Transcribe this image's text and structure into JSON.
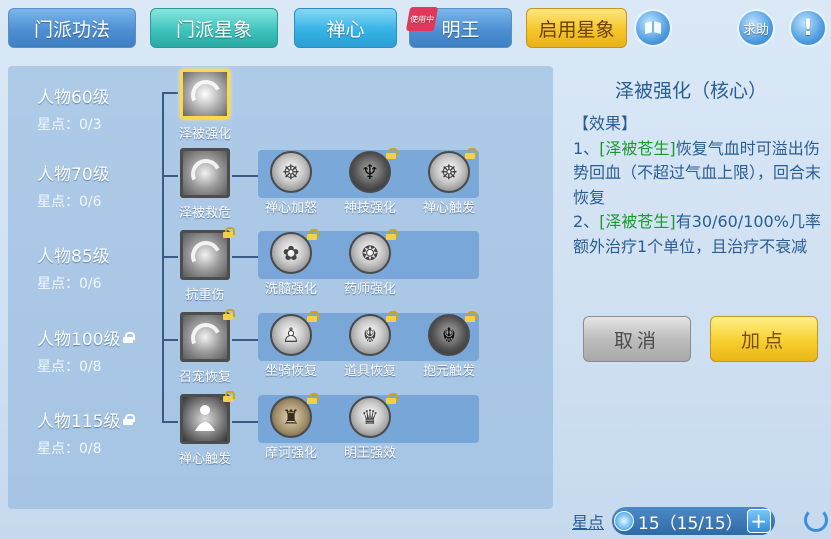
{
  "tabs": [
    {
      "label": "门派功法"
    },
    {
      "label": "门派星象"
    },
    {
      "label": "禅心"
    },
    {
      "label": "明王",
      "badge": "使用中"
    },
    {
      "label": "启用星象"
    }
  ],
  "help_label": "求助",
  "alert_label": "!",
  "levels": [
    {
      "label": "人物60级",
      "points": "星点：0/3",
      "locked": false
    },
    {
      "label": "人物70级",
      "points": "星点：0/6",
      "locked": false
    },
    {
      "label": "人物85级",
      "points": "星点：0/6",
      "locked": false
    },
    {
      "label": "人物100级",
      "points": "星点：0/8",
      "locked": true
    },
    {
      "label": "人物115级",
      "points": "星点：0/8",
      "locked": true
    }
  ],
  "core_skills": [
    "泽被强化",
    "泽被救危",
    "抗重伤",
    "召宠恢复",
    "禅心触发"
  ],
  "branch_skills": [
    [
      "禅心加怒",
      "神技强化",
      "禅心触发"
    ],
    [
      "洗髓强化",
      "药师强化"
    ],
    [
      "坐骑恢复",
      "道具恢复",
      "抱元触发"
    ],
    [
      "摩诃强化",
      "明王强效"
    ]
  ],
  "detail": {
    "title": "泽被强化（核心）",
    "section": "【效果】",
    "line1_prefix": "1、",
    "line1_tag": "[泽被苍生]",
    "line1_text": "恢复气血时可溢出伤势回血（不超过气血上限），回合末恢复",
    "line2_prefix": "2、",
    "line2_tag": "[泽被苍生]",
    "line2_text": "有30/60/100%几率额外治疗1个单位，且治疗不衰减"
  },
  "buttons": {
    "cancel": "取消",
    "add": "加点"
  },
  "star_points": {
    "label": "星点",
    "value": "15（15/15）"
  }
}
